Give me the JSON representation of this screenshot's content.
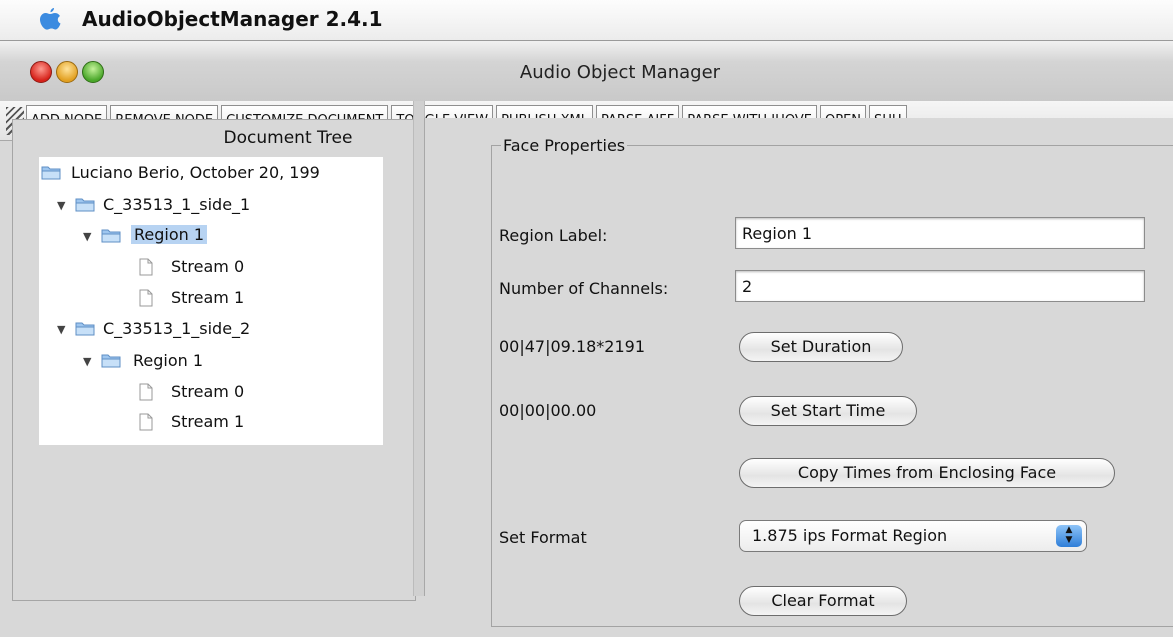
{
  "menubar": {
    "app_name": "AudioObjectManager 2.4.1"
  },
  "window": {
    "title": "Audio Object Manager"
  },
  "toolbar": {
    "buttons": [
      "ADD NODE",
      "REMOVE NODE",
      "CUSTOMIZE DOCUMENT",
      "TOGGLE VIEW",
      "PUBLISH XML",
      "PARSE AIFF",
      "PARSE WITH JHOVE",
      "OPEN",
      "SHU"
    ]
  },
  "tree": {
    "title": "Document Tree",
    "root": "Luciano Berio, October 20, 199",
    "side1": "C_33513_1_side_1",
    "side1_region": "Region 1",
    "side1_stream0": "Stream 0",
    "side1_stream1": "Stream 1",
    "side2": "C_33513_1_side_2",
    "side2_region": "Region 1",
    "side2_stream0": "Stream 0",
    "side2_stream1": "Stream 1"
  },
  "properties": {
    "legend": "Face Properties",
    "region_label_label": "Region Label:",
    "region_label_value": "Region 1",
    "channels_label": "Number of Channels:",
    "channels_value": "2",
    "duration_value": "00|47|09.18*2191",
    "set_duration": "Set Duration",
    "start_time_value": "00|00|00.00",
    "set_start_time": "Set Start Time",
    "copy_times": "Copy Times from Enclosing Face",
    "set_format_label": "Set Format",
    "format_selected": "1.875 ips Format Region",
    "clear_format": "Clear Format"
  }
}
